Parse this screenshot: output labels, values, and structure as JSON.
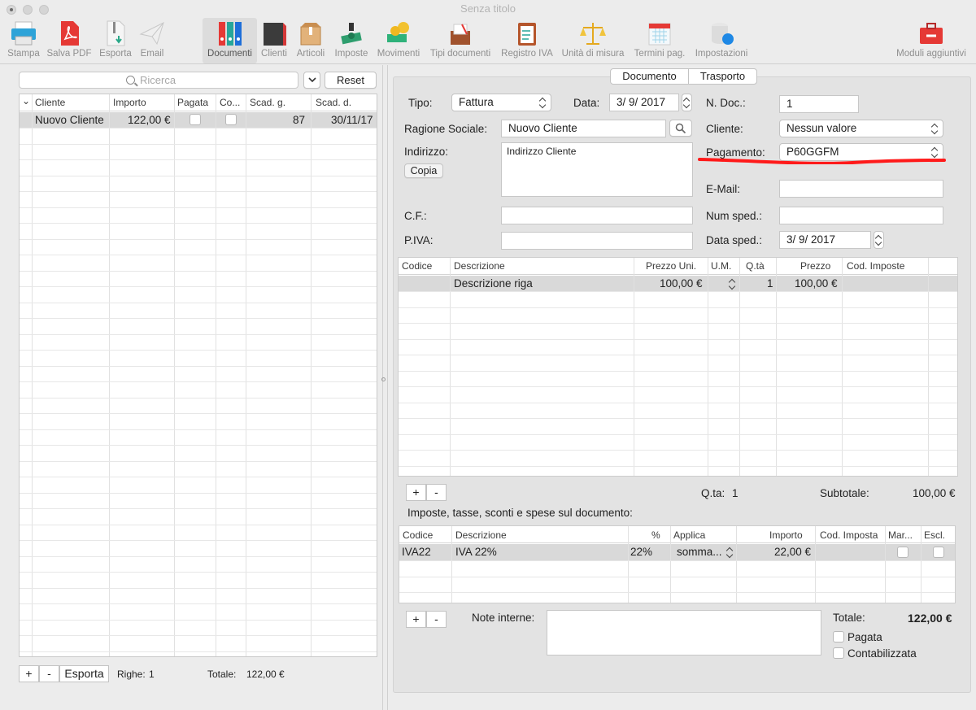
{
  "window": {
    "title": "Senza titolo"
  },
  "toolbar": {
    "items": [
      {
        "label": "Stampa",
        "icon": "printer-icon"
      },
      {
        "label": "Salva PDF",
        "icon": "pdf-icon"
      },
      {
        "label": "Esporta",
        "icon": "zip-export-icon"
      },
      {
        "label": "Email",
        "icon": "paper-plane-icon"
      },
      {
        "label": "Documenti",
        "icon": "binders-icon"
      },
      {
        "label": "Clienti",
        "icon": "address-book-icon"
      },
      {
        "label": "Articoli",
        "icon": "box-icon"
      },
      {
        "label": "Imposte",
        "icon": "money-stamp-icon"
      },
      {
        "label": "Movimenti",
        "icon": "cash-icon"
      },
      {
        "label": "Tipi documenti",
        "icon": "document-types-icon"
      },
      {
        "label": "Registro IVA",
        "icon": "clipboard-icon"
      },
      {
        "label": "Unità di misura",
        "icon": "scales-icon"
      },
      {
        "label": "Termini pag.",
        "icon": "calendar-icon"
      },
      {
        "label": "Impostazioni",
        "icon": "settings-db-icon"
      },
      {
        "label": "Moduli aggiuntivi",
        "icon": "toolbox-icon"
      }
    ]
  },
  "left": {
    "search_placeholder": "Ricerca",
    "reset_label": "Reset",
    "columns": [
      "Cliente",
      "Importo",
      "Pagata",
      "Co...",
      "Scad. g.",
      "Scad. d."
    ],
    "rows": [
      {
        "cliente": "Nuovo Cliente",
        "importo": "122,00 €",
        "scad_g": "87",
        "scad_d": "30/11/17"
      }
    ],
    "add_label": "+",
    "remove_label": "-",
    "export_label": "Esporta",
    "righe_label": "Righe:",
    "righe_value": "1",
    "totale_label": "Totale:",
    "totale_value": "122,00 €"
  },
  "tabs": {
    "documento": "Documento",
    "trasporto": "Trasporto"
  },
  "form": {
    "tipo_label": "Tipo:",
    "tipo_value": "Fattura",
    "data_label": "Data:",
    "data_value": "3/ 9/ 2017",
    "ndoc_label": "N. Doc.:",
    "ndoc_value": "1",
    "ragione_label": "Ragione Sociale:",
    "ragione_value": "Nuovo Cliente",
    "cliente_label": "Cliente:",
    "cliente_value": "Nessun valore",
    "indirizzo_label": "Indirizzo:",
    "indirizzo_value": "Indirizzo Cliente",
    "copia_label": "Copia",
    "pagamento_label": "Pagamento:",
    "pagamento_value": "P60GGFM",
    "email_label": "E-Mail:",
    "email_value": "",
    "cf_label": "C.F.:",
    "cf_value": "",
    "numsped_label": "Num sped.:",
    "numsped_value": "",
    "piva_label": "P.IVA:",
    "piva_value": "",
    "datasped_label": "Data sped.:",
    "datasped_value": "3/ 9/ 2017"
  },
  "lines": {
    "columns": [
      "Codice",
      "Descrizione",
      "Prezzo Uni.",
      "U.M.",
      "Q.tà",
      "Prezzo",
      "Cod. Imposte"
    ],
    "rows": [
      {
        "codice": "",
        "descrizione": "Descrizione riga",
        "prezzo_uni": "100,00 €",
        "um": "",
        "qta": "1",
        "prezzo": "100,00 €",
        "cod_imposte": ""
      }
    ],
    "qta_label": "Q.ta:",
    "qta_value": "1",
    "subtotale_label": "Subtotale:",
    "subtotale_value": "100,00 €"
  },
  "taxes": {
    "section_title": "Imposte, tasse, sconti e spese sul documento:",
    "columns": [
      "Codice",
      "Descrizione",
      "%",
      "Applica",
      "Importo",
      "Cod. Imposta",
      "Mar...",
      "Escl."
    ],
    "rows": [
      {
        "codice": "IVA22",
        "descrizione": "IVA 22%",
        "perc": "22%",
        "applica": "somma...",
        "importo": "22,00 €",
        "cod_imposta": ""
      }
    ]
  },
  "footer": {
    "note_label": "Note interne:",
    "totale_label": "Totale:",
    "totale_value": "122,00 €",
    "pagata_label": "Pagata",
    "contabilizzata_label": "Contabilizzata"
  },
  "colors": {
    "highlight_red": "#ff1a1a",
    "selected_row": "#d9d9d9"
  }
}
